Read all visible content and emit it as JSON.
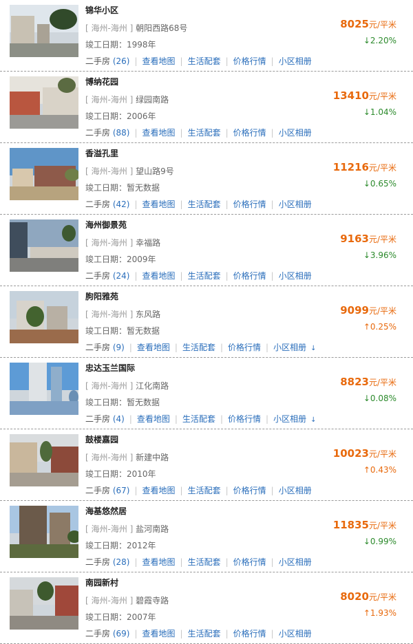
{
  "listings": [
    {
      "name": "锦华小区",
      "region": "[ 海州-海州 ]",
      "street": "朝阳西路68号",
      "built_label": "竣工日期：",
      "built_value": "1998年",
      "second_hand_label": "二手房",
      "second_hand_count": "(26)",
      "links": [
        "查看地图",
        "生活配套",
        "价格行情",
        "小区相册"
      ],
      "more": "",
      "price": "8025",
      "unit": "元/平米",
      "direction": "down",
      "arrow": "↓",
      "change": "2.20%",
      "thumb": {
        "sky": "#dfe6ec",
        "ground": "#8c8f86",
        "bldg": "#c8c1b3",
        "bldg2": "#a9a295",
        "tree": "#314a2a"
      }
    },
    {
      "name": "博纳花园",
      "region": "[ 海州-海州 ]",
      "street": "绿园南路",
      "built_label": "竣工日期：",
      "built_value": "2006年",
      "second_hand_label": "二手房",
      "second_hand_count": "(88)",
      "links": [
        "查看地图",
        "生活配套",
        "价格行情",
        "小区相册"
      ],
      "more": "",
      "price": "13410",
      "unit": "元/平米",
      "direction": "down",
      "arrow": "↓",
      "change": "1.04%",
      "thumb": {
        "sky": "#e6e3dc",
        "ground": "#9b9a96",
        "bldg": "#b9563f",
        "bldg2": "#d9d3c8",
        "tree": "#5b6b42"
      }
    },
    {
      "name": "香溢孔里",
      "region": "[ 海州-海州 ]",
      "street": "望山路9号",
      "built_label": "竣工日期：",
      "built_value": "暂无数据",
      "second_hand_label": "二手房",
      "second_hand_count": "(42)",
      "links": [
        "查看地图",
        "生活配套",
        "价格行情",
        "小区相册"
      ],
      "more": "",
      "price": "11216",
      "unit": "元/平米",
      "direction": "down",
      "arrow": "↓",
      "change": "0.65%",
      "thumb": {
        "sky": "#5f95c8",
        "ground": "#b7a37e",
        "bldg": "#d8c8ad",
        "bldg2": "#8e5a4a",
        "tree": "#6f7f48"
      }
    },
    {
      "name": "海州御景苑",
      "region": "[ 海州-海州 ]",
      "street": "幸福路",
      "built_label": "竣工日期：",
      "built_value": "2009年",
      "second_hand_label": "二手房",
      "second_hand_count": "(24)",
      "links": [
        "查看地图",
        "生活配套",
        "价格行情",
        "小区相册"
      ],
      "more": "",
      "price": "9163",
      "unit": "元/平米",
      "direction": "down",
      "arrow": "↓",
      "change": "3.96%",
      "thumb": {
        "sky": "#8fa7bf",
        "ground": "#7f7f7c",
        "bldg": "#3f4d5c",
        "bldg2": "#cfcac0",
        "tree": "#3e5a32"
      }
    },
    {
      "name": "朐阳雅苑",
      "region": "[ 海州-海州 ]",
      "street": "东风路",
      "built_label": "竣工日期：",
      "built_value": "暂无数据",
      "second_hand_label": "二手房",
      "second_hand_count": "(9)",
      "links": [
        "查看地图",
        "生活配套",
        "价格行情",
        "小区相册"
      ],
      "more": "↓",
      "price": "9099",
      "unit": "元/平米",
      "direction": "up",
      "arrow": "↑",
      "change": "0.25%",
      "thumb": {
        "sky": "#c6d2dc",
        "ground": "#9a6b4b",
        "bldg": "#d7d3cb",
        "bldg2": "#b8b0a4",
        "tree": "#43632f"
      }
    },
    {
      "name": "忠达玉兰国际",
      "region": "[ 海州-海州 ]",
      "street": "江化南路",
      "built_label": "竣工日期：",
      "built_value": "暂无数据",
      "second_hand_label": "二手房",
      "second_hand_count": "(4)",
      "links": [
        "查看地图",
        "生活配套",
        "价格行情",
        "小区相册"
      ],
      "more": "↓",
      "price": "8823",
      "unit": "元/平米",
      "direction": "down",
      "arrow": "↓",
      "change": "0.08%",
      "thumb": {
        "sky": "#5d9bd6",
        "ground": "#7ea0c4",
        "bldg": "#dfe3e6",
        "bldg2": "#8faecb",
        "tree": "#6a8fb4"
      }
    },
    {
      "name": "鼓楼嘉园",
      "region": "[ 海州-海州 ]",
      "street": "新建中路",
      "built_label": "竣工日期：",
      "built_value": "2010年",
      "second_hand_label": "二手房",
      "second_hand_count": "(67)",
      "links": [
        "查看地图",
        "生活配套",
        "价格行情",
        "小区相册"
      ],
      "more": "",
      "price": "10023",
      "unit": "元/平米",
      "direction": "up",
      "arrow": "↑",
      "change": "0.43%",
      "thumb": {
        "sky": "#d9dcde",
        "ground": "#a59d91",
        "bldg": "#c9b79c",
        "bldg2": "#8c4a3a",
        "tree": "#4f6a3b"
      }
    },
    {
      "name": "海基悠然居",
      "region": "[ 海州-海州 ]",
      "street": "盐河南路",
      "built_label": "竣工日期：",
      "built_value": "2012年",
      "second_hand_label": "二手房",
      "second_hand_count": "(28)",
      "links": [
        "查看地图",
        "生活配套",
        "价格行情",
        "小区相册"
      ],
      "more": "",
      "price": "11835",
      "unit": "元/平米",
      "direction": "down",
      "arrow": "↓",
      "change": "0.99%",
      "thumb": {
        "sky": "#a9c6e2",
        "ground": "#5c6a3e",
        "bldg": "#6b5a4a",
        "bldg2": "#8c7a66",
        "tree": "#3d5a2c"
      }
    },
    {
      "name": "南园新村",
      "region": "[ 海州-海州 ]",
      "street": "碧霞寺路",
      "built_label": "竣工日期：",
      "built_value": "2007年",
      "second_hand_label": "二手房",
      "second_hand_count": "(69)",
      "links": [
        "查看地图",
        "生活配套",
        "价格行情",
        "小区相册"
      ],
      "more": "",
      "price": "8020",
      "unit": "元/平米",
      "direction": "up",
      "arrow": "↑",
      "change": "1.93%",
      "thumb": {
        "sky": "#d5d9dc",
        "ground": "#8f8a82",
        "bldg": "#c7c2b8",
        "bldg2": "#a0483a",
        "tree": "#3e5a2e"
      }
    }
  ]
}
